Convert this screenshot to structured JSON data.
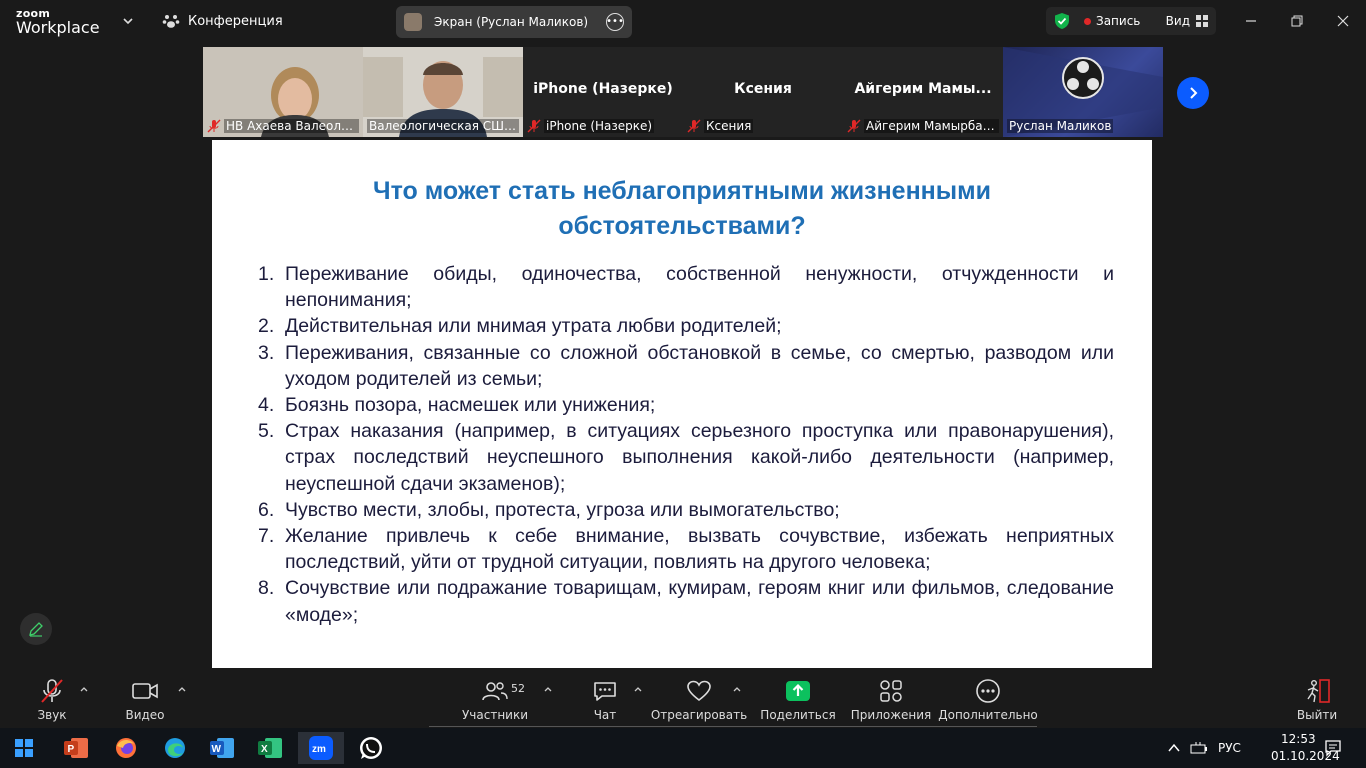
{
  "app": {
    "logo_line1": "zoom",
    "logo_line2": "Workplace",
    "conference_label": "Конференция",
    "screen_share_label": "Экран (Руслан Маликов)",
    "record_label": "Запись",
    "view_label": "Вид"
  },
  "participants": [
    {
      "display": "",
      "name": "НВ Ахаева Валеолог...",
      "muted": true
    },
    {
      "display": "",
      "name": "Валеологическая СШК ...",
      "muted": false
    },
    {
      "display": "iPhone (Назерке)",
      "name": "iPhone (Назерке)",
      "muted": true
    },
    {
      "display": "Ксения",
      "name": "Ксения",
      "muted": true
    },
    {
      "display": "Айгерим  Мамы...",
      "name": "Айгерим Мамырбае...",
      "muted": true
    },
    {
      "display": "",
      "name": "Руслан Маликов",
      "muted": false
    }
  ],
  "slide": {
    "title": "Что может стать неблагоприятными жизненными обстоятельствами?",
    "items": [
      {
        "num": "1.",
        "text": "Переживание обиды, одиночества, собственной ненужности, отчужденности и непонимания;"
      },
      {
        "num": "2.",
        "text": " Действительная или мнимая утрата любви родителей;"
      },
      {
        "num": "3.",
        "text": "Переживания, связанные со сложной обстановкой в семье, со смертью, разводом или уходом родителей из семьи;"
      },
      {
        "num": "4.",
        "text": "Боязнь позора, насмешек или унижения;"
      },
      {
        "num": "5.",
        "text": "Страх наказания (например, в ситуациях серьезного проступка или правонарушения), страх последствий неуспешного выполнения какой-либо деятельности (например, неуспешной сдачи экзаменов);"
      },
      {
        "num": "6.",
        "text": "Чувство мести, злобы, протеста, угроза или вымогательство;"
      },
      {
        "num": "7.",
        "text": "Желание привлечь к себе внимание, вызвать сочувствие, избежать неприятных последствий, уйти от трудной ситуации, повлиять на другого человека;"
      },
      {
        "num": "8.",
        "text": "Сочувствие или подражание товарищам, кумирам, героям книг или фильмов, следование «моде»;"
      }
    ]
  },
  "toolbar": {
    "audio": "Звук",
    "video": "Видео",
    "participants": "Участники",
    "participants_count": "52",
    "chat": "Чат",
    "react": "Отреагировать",
    "share": "Поделиться",
    "apps": "Приложения",
    "more": "Дополнительно",
    "leave": "Выйти"
  },
  "taskbar": {
    "lang": "РУС",
    "time": "12:53",
    "date": "01.10.2024"
  },
  "colors": {
    "accent_blue": "#0b5cff",
    "share_green": "#0cc15e",
    "title_blue": "#1f6fb5",
    "active_tile": "#2bd26a",
    "leave_red": "#e02828"
  }
}
